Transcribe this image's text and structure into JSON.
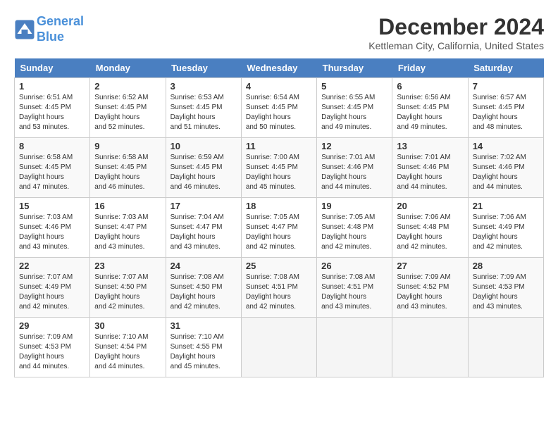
{
  "logo": {
    "line1": "General",
    "line2": "Blue"
  },
  "title": "December 2024",
  "location": "Kettleman City, California, United States",
  "weekdays": [
    "Sunday",
    "Monday",
    "Tuesday",
    "Wednesday",
    "Thursday",
    "Friday",
    "Saturday"
  ],
  "weeks": [
    [
      {
        "day": "1",
        "sunrise": "6:51 AM",
        "sunset": "4:45 PM",
        "daylight": "9 hours and 53 minutes."
      },
      {
        "day": "2",
        "sunrise": "6:52 AM",
        "sunset": "4:45 PM",
        "daylight": "9 hours and 52 minutes."
      },
      {
        "day": "3",
        "sunrise": "6:53 AM",
        "sunset": "4:45 PM",
        "daylight": "9 hours and 51 minutes."
      },
      {
        "day": "4",
        "sunrise": "6:54 AM",
        "sunset": "4:45 PM",
        "daylight": "9 hours and 50 minutes."
      },
      {
        "day": "5",
        "sunrise": "6:55 AM",
        "sunset": "4:45 PM",
        "daylight": "9 hours and 49 minutes."
      },
      {
        "day": "6",
        "sunrise": "6:56 AM",
        "sunset": "4:45 PM",
        "daylight": "9 hours and 49 minutes."
      },
      {
        "day": "7",
        "sunrise": "6:57 AM",
        "sunset": "4:45 PM",
        "daylight": "9 hours and 48 minutes."
      }
    ],
    [
      {
        "day": "8",
        "sunrise": "6:58 AM",
        "sunset": "4:45 PM",
        "daylight": "9 hours and 47 minutes."
      },
      {
        "day": "9",
        "sunrise": "6:58 AM",
        "sunset": "4:45 PM",
        "daylight": "9 hours and 46 minutes."
      },
      {
        "day": "10",
        "sunrise": "6:59 AM",
        "sunset": "4:45 PM",
        "daylight": "9 hours and 46 minutes."
      },
      {
        "day": "11",
        "sunrise": "7:00 AM",
        "sunset": "4:45 PM",
        "daylight": "9 hours and 45 minutes."
      },
      {
        "day": "12",
        "sunrise": "7:01 AM",
        "sunset": "4:46 PM",
        "daylight": "9 hours and 44 minutes."
      },
      {
        "day": "13",
        "sunrise": "7:01 AM",
        "sunset": "4:46 PM",
        "daylight": "9 hours and 44 minutes."
      },
      {
        "day": "14",
        "sunrise": "7:02 AM",
        "sunset": "4:46 PM",
        "daylight": "9 hours and 44 minutes."
      }
    ],
    [
      {
        "day": "15",
        "sunrise": "7:03 AM",
        "sunset": "4:46 PM",
        "daylight": "9 hours and 43 minutes."
      },
      {
        "day": "16",
        "sunrise": "7:03 AM",
        "sunset": "4:47 PM",
        "daylight": "9 hours and 43 minutes."
      },
      {
        "day": "17",
        "sunrise": "7:04 AM",
        "sunset": "4:47 PM",
        "daylight": "9 hours and 43 minutes."
      },
      {
        "day": "18",
        "sunrise": "7:05 AM",
        "sunset": "4:47 PM",
        "daylight": "9 hours and 42 minutes."
      },
      {
        "day": "19",
        "sunrise": "7:05 AM",
        "sunset": "4:48 PM",
        "daylight": "9 hours and 42 minutes."
      },
      {
        "day": "20",
        "sunrise": "7:06 AM",
        "sunset": "4:48 PM",
        "daylight": "9 hours and 42 minutes."
      },
      {
        "day": "21",
        "sunrise": "7:06 AM",
        "sunset": "4:49 PM",
        "daylight": "9 hours and 42 minutes."
      }
    ],
    [
      {
        "day": "22",
        "sunrise": "7:07 AM",
        "sunset": "4:49 PM",
        "daylight": "9 hours and 42 minutes."
      },
      {
        "day": "23",
        "sunrise": "7:07 AM",
        "sunset": "4:50 PM",
        "daylight": "9 hours and 42 minutes."
      },
      {
        "day": "24",
        "sunrise": "7:08 AM",
        "sunset": "4:50 PM",
        "daylight": "9 hours and 42 minutes."
      },
      {
        "day": "25",
        "sunrise": "7:08 AM",
        "sunset": "4:51 PM",
        "daylight": "9 hours and 42 minutes."
      },
      {
        "day": "26",
        "sunrise": "7:08 AM",
        "sunset": "4:51 PM",
        "daylight": "9 hours and 43 minutes."
      },
      {
        "day": "27",
        "sunrise": "7:09 AM",
        "sunset": "4:52 PM",
        "daylight": "9 hours and 43 minutes."
      },
      {
        "day": "28",
        "sunrise": "7:09 AM",
        "sunset": "4:53 PM",
        "daylight": "9 hours and 43 minutes."
      }
    ],
    [
      {
        "day": "29",
        "sunrise": "7:09 AM",
        "sunset": "4:53 PM",
        "daylight": "9 hours and 44 minutes."
      },
      {
        "day": "30",
        "sunrise": "7:10 AM",
        "sunset": "4:54 PM",
        "daylight": "9 hours and 44 minutes."
      },
      {
        "day": "31",
        "sunrise": "7:10 AM",
        "sunset": "4:55 PM",
        "daylight": "9 hours and 45 minutes."
      },
      null,
      null,
      null,
      null
    ]
  ],
  "labels": {
    "sunrise": "Sunrise:",
    "sunset": "Sunset:",
    "daylight": "Daylight hours"
  }
}
